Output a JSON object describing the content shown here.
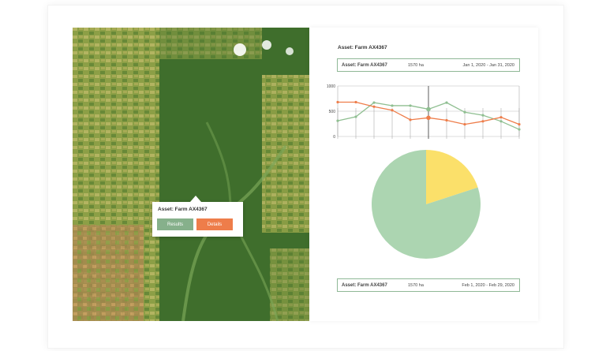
{
  "popup": {
    "title": "Asset: Farm AX4367",
    "results_label": "Results",
    "details_label": "Details"
  },
  "panel": {
    "title": "Asset: Farm AX4367",
    "top_bar": {
      "asset": "Asset: Farm AX4367",
      "area": "1570 ha",
      "range": "Jan 1, 2020 - Jan 31, 2020"
    },
    "bottom_bar": {
      "asset": "Asset: Farm AX4367",
      "area": "1570 ha",
      "range": "Feb 1, 2020 - Feb 29, 2020"
    }
  },
  "colors": {
    "green": "#8fbf91",
    "orange": "#ee7d4a",
    "pie_green": "#acd5b1",
    "pie_yellow": "#fbe06a",
    "frame_green": "#8fb896"
  },
  "chart_data": [
    {
      "type": "line",
      "x": [
        1,
        2,
        3,
        4,
        5,
        6,
        7,
        8,
        9,
        10,
        11
      ],
      "ylim": [
        0,
        1000
      ],
      "yticks": [
        "1000",
        "500",
        "0"
      ],
      "highlight_index": 5,
      "series": [
        {
          "color": "#8fbf91",
          "values": [
            310,
            390,
            670,
            610,
            610,
            540,
            670,
            480,
            420,
            300,
            140
          ]
        },
        {
          "color": "#ee7d4a",
          "values": [
            680,
            680,
            590,
            520,
            330,
            370,
            320,
            240,
            300,
            380,
            240
          ]
        }
      ]
    },
    {
      "type": "pie",
      "slices": [
        {
          "color": "#fbe06a",
          "value": 20
        },
        {
          "color": "#acd5b1",
          "value": 80
        }
      ]
    }
  ]
}
